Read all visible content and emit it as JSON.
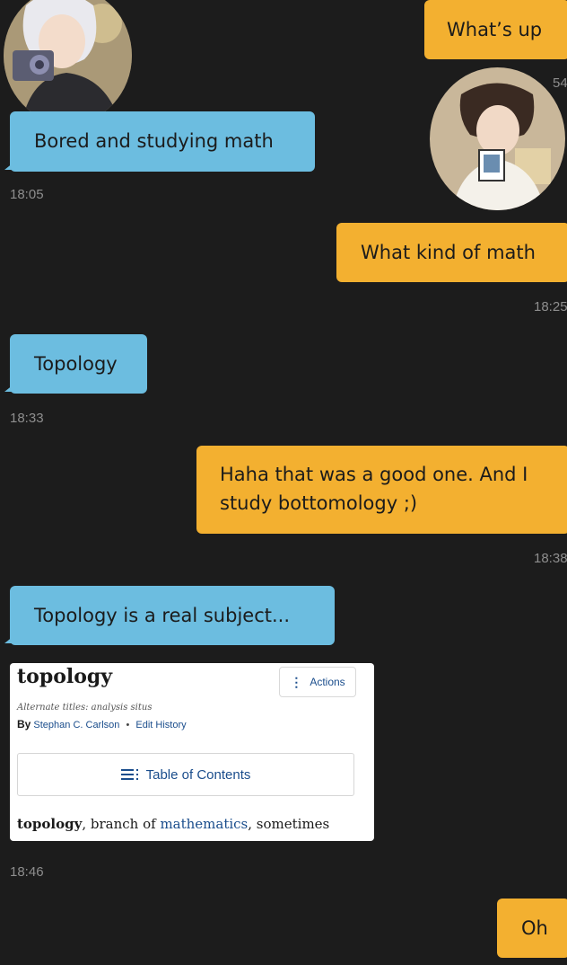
{
  "messages": [
    {
      "id": "m1",
      "side": "out",
      "text": "What’s up"
    },
    {
      "id": "m2",
      "side": "in",
      "text": "Bored and studying math",
      "time": "18:05"
    },
    {
      "id": "m3",
      "side": "out",
      "text": "What kind of math",
      "time": "18:25"
    },
    {
      "id": "m4",
      "side": "in",
      "text": "Topology",
      "time": "18:33"
    },
    {
      "id": "m5",
      "side": "out",
      "text_lines": [
        "Haha that was a good one. And I",
        "study bottomology ;)"
      ],
      "time": "18:38"
    },
    {
      "id": "m6",
      "side": "in",
      "text": "Topology is a real subject...",
      "time": "18:46"
    },
    {
      "id": "m7",
      "side": "out",
      "text": "Oh"
    }
  ],
  "partial_time_top": "54",
  "card": {
    "title": "topology",
    "actions_label": "Actions",
    "alternate_titles": "Alternate titles: analysis situs",
    "by_label": "By",
    "author": "Stephan C. Carlson",
    "edit_history": "Edit History",
    "toc_label": "Table of Contents",
    "text_bold": "topology",
    "text_part1": ", branch of ",
    "text_link": "mathematics",
    "text_part2": ", sometimes"
  },
  "colors": {
    "background": "#1c1c1c",
    "incoming_bubble": "#6cbde0",
    "outgoing_bubble": "#f3b030",
    "timestamp": "#8e8e8e",
    "link": "#1a4d8c"
  },
  "icons": [
    "avatar-user-left",
    "avatar-user-right",
    "kebab-menu-icon",
    "list-icon"
  ]
}
